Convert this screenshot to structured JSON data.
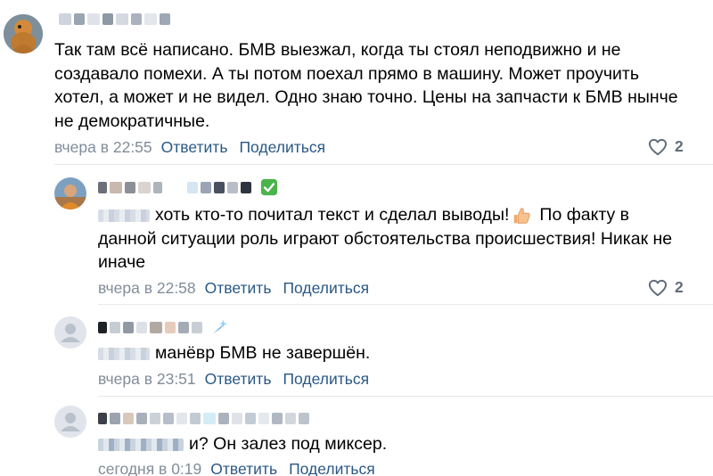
{
  "comments": [
    {
      "text_lines": [
        "Так там всё написано. БМВ выезжал, когда ты стоял неподвижно и не",
        "создавало помехи. А ты потом поехал прямо в машину. Может проучить",
        "хотел, а может и не видел. Одно знаю точно. Цены на запчасти к БМВ нынче",
        "не демократичные."
      ],
      "time": "вчера в 22:55",
      "reply_label": "Ответить",
      "share_label": "Поделиться",
      "likes": "2"
    },
    {
      "text_lines": [
        "хоть кто-то почитал текст и сделал выводы!",
        "По факту в",
        "данной ситуации роль играют обстоятельства происшествия! Никак не",
        "иначе"
      ],
      "time": "вчера в 22:58",
      "reply_label": "Ответить",
      "share_label": "Поделиться",
      "likes": "2"
    },
    {
      "text_lines": [
        "манёвр БМВ не завершён."
      ],
      "time": "вчера в 23:51",
      "reply_label": "Ответить",
      "share_label": "Поделиться"
    },
    {
      "text_lines": [
        "и? Он залез под миксер."
      ],
      "time": "сегодня в 0:19",
      "reply_label": "Ответить",
      "share_label": "Поделиться"
    }
  ],
  "colors": {
    "link": "#2a5885",
    "meta": "#818c99",
    "divider": "#e7e8ec",
    "like": "#626d7a",
    "verified": "#4bb34b"
  },
  "icons": {
    "like": "heart-outline-icon",
    "verified": "check-mark-button-icon",
    "thumbs_up": "thumbs-up-emoji-icon",
    "decoration": "blue-star-sparkle-icon",
    "default_avatar": "person-silhouette-icon"
  }
}
